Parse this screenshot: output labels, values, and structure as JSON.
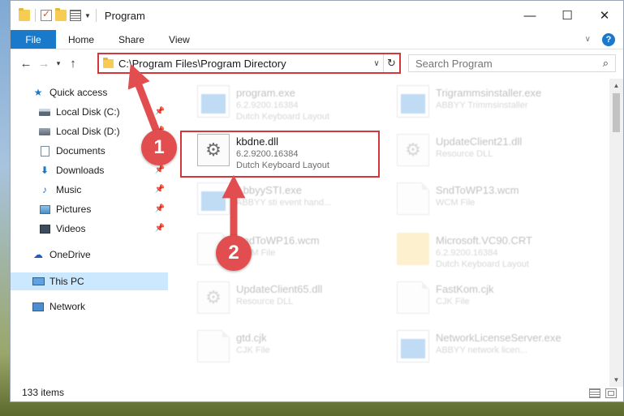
{
  "window": {
    "title": "Program",
    "controls": {
      "minimize": "—",
      "maximize": "☐",
      "close": "✕"
    }
  },
  "ribbon": {
    "tabs": [
      "File",
      "Home",
      "Share",
      "View"
    ]
  },
  "address_bar": {
    "path": "C:\\Program Files\\Program Directory"
  },
  "search": {
    "placeholder": "Search Program"
  },
  "sidebar": {
    "items": [
      {
        "label": "Quick access",
        "icon": "star-icon"
      },
      {
        "label": "Local Disk (C:)",
        "icon": "drive-icon",
        "pinned": true
      },
      {
        "label": "Local Disk (D:)",
        "icon": "drive-icon",
        "pinned": true
      },
      {
        "label": "Documents",
        "icon": "documents-icon",
        "pinned": true
      },
      {
        "label": "Downloads",
        "icon": "downloads-icon",
        "pinned": true
      },
      {
        "label": "Music",
        "icon": "music-icon",
        "pinned": true
      },
      {
        "label": "Pictures",
        "icon": "pictures-icon",
        "pinned": true
      },
      {
        "label": "Videos",
        "icon": "videos-icon",
        "pinned": true
      },
      {
        "label": "OneDrive",
        "icon": "onedrive-icon"
      },
      {
        "label": "This PC",
        "icon": "this-pc-icon",
        "selected": true
      },
      {
        "label": "Network",
        "icon": "network-icon"
      }
    ]
  },
  "files": [
    {
      "name": "program.exe",
      "line1": "6.2.9200.16384",
      "line2": "Dutch Keyboard Layout",
      "icon": "exe-icon"
    },
    {
      "name": "Trigrammsinstaller.exe",
      "line1": "ABBYY Trimmsinstaller",
      "line2": "",
      "icon": "exe-icon"
    },
    {
      "name": "kbdne.dll",
      "line1": "6.2.9200.16384",
      "line2": "Dutch Keyboard Layout",
      "icon": "dll-gear-icon"
    },
    {
      "name": "UpdateClient21.dll",
      "line1": "Resource DLL",
      "line2": "",
      "icon": "dll-gear-icon"
    },
    {
      "name": "AbbyySTI.exe",
      "line1": "ABBYY sti event hand...",
      "line2": "",
      "icon": "exe-icon"
    },
    {
      "name": "SndToWP13.wcm",
      "line1": "WCM File",
      "line2": "",
      "icon": "file-icon"
    },
    {
      "name": "SndToWP16.wcm",
      "line1": "WCM File",
      "line2": "",
      "icon": "file-icon"
    },
    {
      "name": "Microsoft.VC90.CRT",
      "line1": "6.2.9200.16384",
      "line2": "Dutch Keyboard Layout",
      "icon": "folder-icon"
    },
    {
      "name": "UpdateClient65.dll",
      "line1": "Resource DLL",
      "line2": "",
      "icon": "dll-gear-icon"
    },
    {
      "name": "FastKom.cjk",
      "line1": "CJK File",
      "line2": "",
      "icon": "file-icon"
    },
    {
      "name": "gtd.cjk",
      "line1": "CJK File",
      "line2": "",
      "icon": "file-icon"
    },
    {
      "name": "NetworkLicenseServer.exe",
      "line1": "ABBYY network licen...",
      "line2": "",
      "icon": "exe-icon"
    }
  ],
  "status": {
    "item_count": "133 items"
  },
  "callouts": {
    "first": "1",
    "second": "2"
  },
  "colors": {
    "accent": "#1979ca",
    "highlight": "#d2373c",
    "badge": "#e24e4f",
    "selection": "#cce8ff"
  }
}
